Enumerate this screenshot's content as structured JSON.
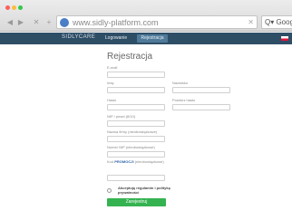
{
  "browser": {
    "nav": {
      "back": "◀",
      "forward": "▶",
      "close": "✕",
      "new_tab": "+"
    },
    "url": "www.sidly-platform.com",
    "search_text": "Q▾ Googl"
  },
  "site": {
    "logo": "SIDLYCARE",
    "tabs": [
      {
        "label": "Logowanie"
      },
      {
        "label": "Rejestracja"
      }
    ]
  },
  "form": {
    "title": "Rejestracja",
    "fields": {
      "email": {
        "label": "E-mail"
      },
      "first_name": {
        "label": "Imię"
      },
      "last_name": {
        "label": "Nazwisko"
      },
      "password": {
        "label": "Hasło"
      },
      "repeat_password": {
        "label": "Powtórz hasło"
      },
      "nip": {
        "label": "NIP / pesel (8/10)"
      },
      "company_name": {
        "label": "Nazwa firmy (nieobowiązkowe)"
      },
      "company_nip": {
        "label": "Numer NIP (nieobowiązkowe)"
      },
      "privacy": {
        "label_prefix": "Kod",
        "label_link": "PROMOCJI",
        "label_suffix": "(nieobowiązkowe)"
      }
    },
    "accept_text": "Akceptuję regulamin i politykę prywatności",
    "submit_label": "Zarejestruj"
  }
}
